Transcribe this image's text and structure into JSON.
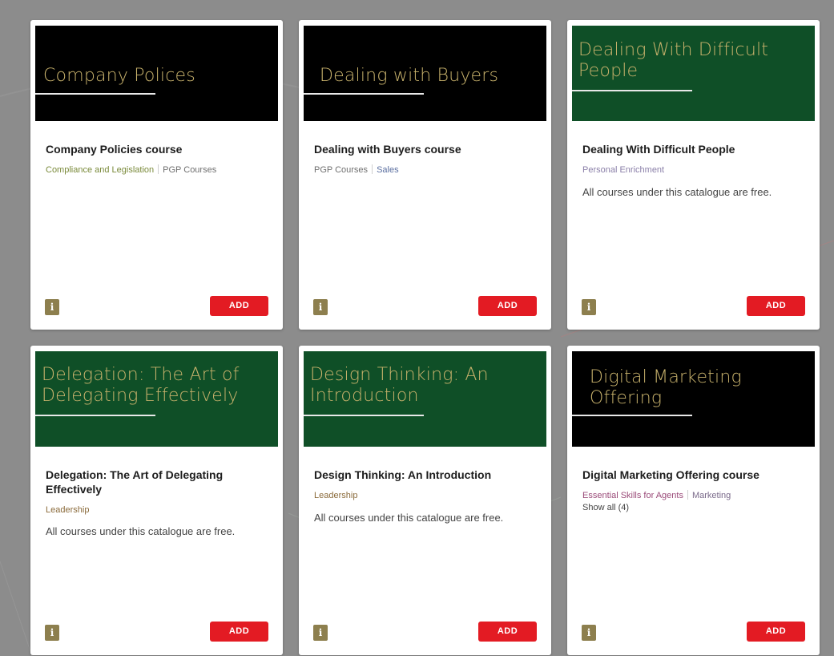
{
  "colors": {
    "background": "#8c8c8c",
    "thumb_black": "#000000",
    "thumb_green": "#0f4f27",
    "thumb_text": "#c8b26c",
    "add_button": "#e31b23",
    "info_button": "#8d7f4e"
  },
  "cards": [
    {
      "thumb_text": "Company Polices",
      "title": "Company Policies course",
      "tags": [
        {
          "label": "Compliance and Legislation",
          "color": "#7a8a3a"
        },
        {
          "label": "PGP Courses",
          "color": "#6f6f6f"
        }
      ],
      "show_all": "",
      "description": "",
      "info_label": "i",
      "add_label": "ADD"
    },
    {
      "thumb_text": "Dealing with Buyers",
      "title": "Dealing with Buyers course",
      "tags": [
        {
          "label": "PGP Courses",
          "color": "#6f6f6f"
        },
        {
          "label": "Sales",
          "color": "#5b6fa0"
        }
      ],
      "show_all": "",
      "description": "",
      "info_label": "i",
      "add_label": "ADD"
    },
    {
      "thumb_text": "Dealing With Difficult People",
      "title": "Dealing With Difficult People",
      "tags": [
        {
          "label": "Personal Enrichment",
          "color": "#8a7fa8"
        }
      ],
      "show_all": "",
      "description": "All courses under this catalogue are free.",
      "info_label": "i",
      "add_label": "ADD"
    },
    {
      "thumb_text": "Delegation: The Art of Delegating Effectively",
      "title": "Delegation: The Art of Delegating Effectively",
      "tags": [
        {
          "label": "Leadership",
          "color": "#8a6a3a"
        }
      ],
      "show_all": "",
      "description": "All courses under this catalogue are free.",
      "info_label": "i",
      "add_label": "ADD"
    },
    {
      "thumb_text": "Design Thinking: An Introduction",
      "title": "Design Thinking: An Introduction",
      "tags": [
        {
          "label": "Leadership",
          "color": "#8a6a3a"
        }
      ],
      "show_all": "",
      "description": "All courses under this catalogue are free.",
      "info_label": "i",
      "add_label": "ADD"
    },
    {
      "thumb_text": "Digital Marketing Offering",
      "title": "Digital Marketing Offering course",
      "tags": [
        {
          "label": "Essential Skills for Agents",
          "color": "#9a4a78"
        },
        {
          "label": "Marketing",
          "color": "#7a6a8a"
        }
      ],
      "show_all": "Show all (4)",
      "description": "",
      "info_label": "i",
      "add_label": "ADD"
    }
  ]
}
